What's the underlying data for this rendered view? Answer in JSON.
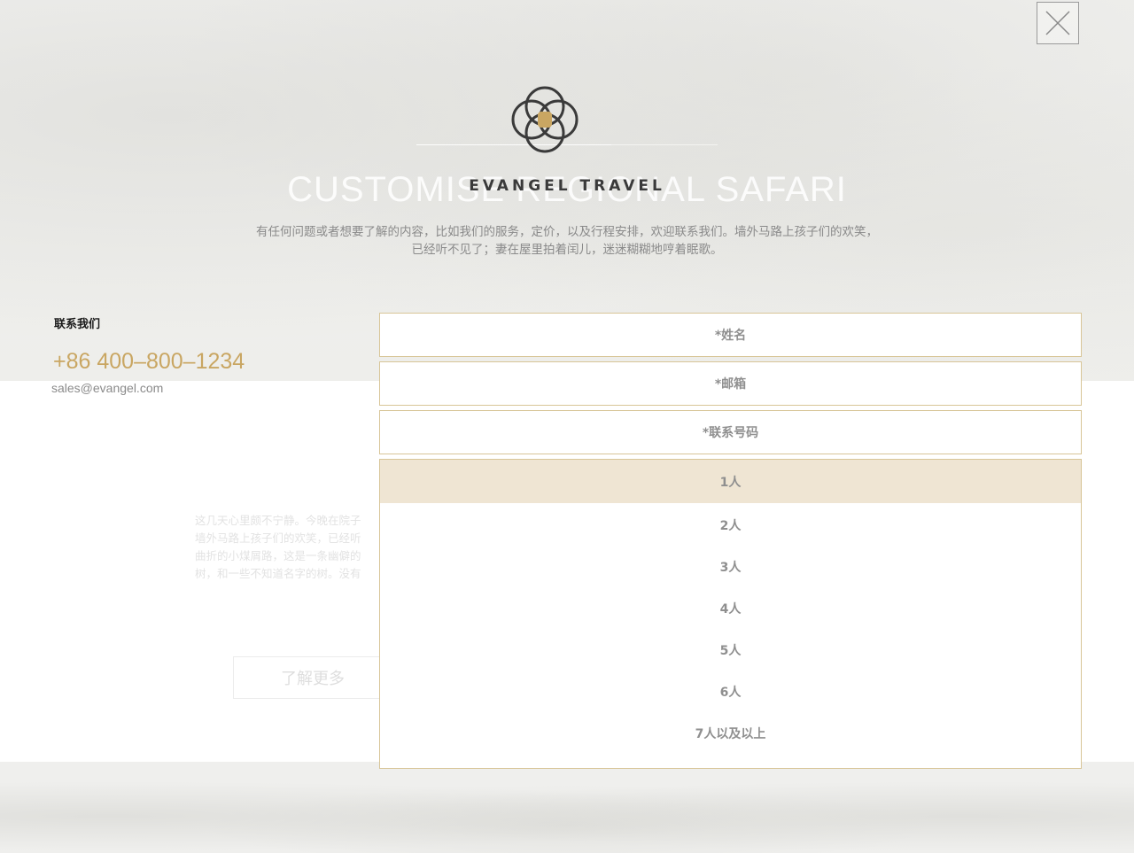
{
  "background": {
    "title": "CUSTOMISE REGIONAL SAFARI",
    "paragraph": [
      "这几天心里颇不宁静。今晚在院子",
      "墙外马路上孩子们的欢笑，已经听",
      "曲折的小煤屑路，这是一条幽僻的",
      "树，和一些不知道名字的树。没有"
    ],
    "more_button": "了解更多"
  },
  "header": {
    "brand_name": "EVANGEL TRAVEL",
    "intro_line1": "有任何问题或者想要了解的内容，比如我们的服务，定价，以及行程安排，欢迎联系我们。墙外马路上孩子们的欢笑，",
    "intro_line2": "已经听不见了；妻在屋里拍着闰儿，迷迷糊糊地哼着眠歌。"
  },
  "contact": {
    "heading": "联系我们",
    "phone": "+86 400–800–1234",
    "email": "sales@evangel.com"
  },
  "form": {
    "name_placeholder": "*姓名",
    "email_placeholder": "*邮箱",
    "phone_placeholder": "*联系号码",
    "party_size_options": [
      "1人",
      "2人",
      "3人",
      "4人",
      "5人",
      "6人",
      "7人以及以上"
    ],
    "party_size_selected": "1人"
  },
  "colors": {
    "accent_gold": "#c9a662",
    "field_border": "#d8c597",
    "selected_option_bg": "#efe5d3"
  },
  "icons": {
    "close": "close-icon",
    "logo": "flower-of-life-logo-icon"
  }
}
